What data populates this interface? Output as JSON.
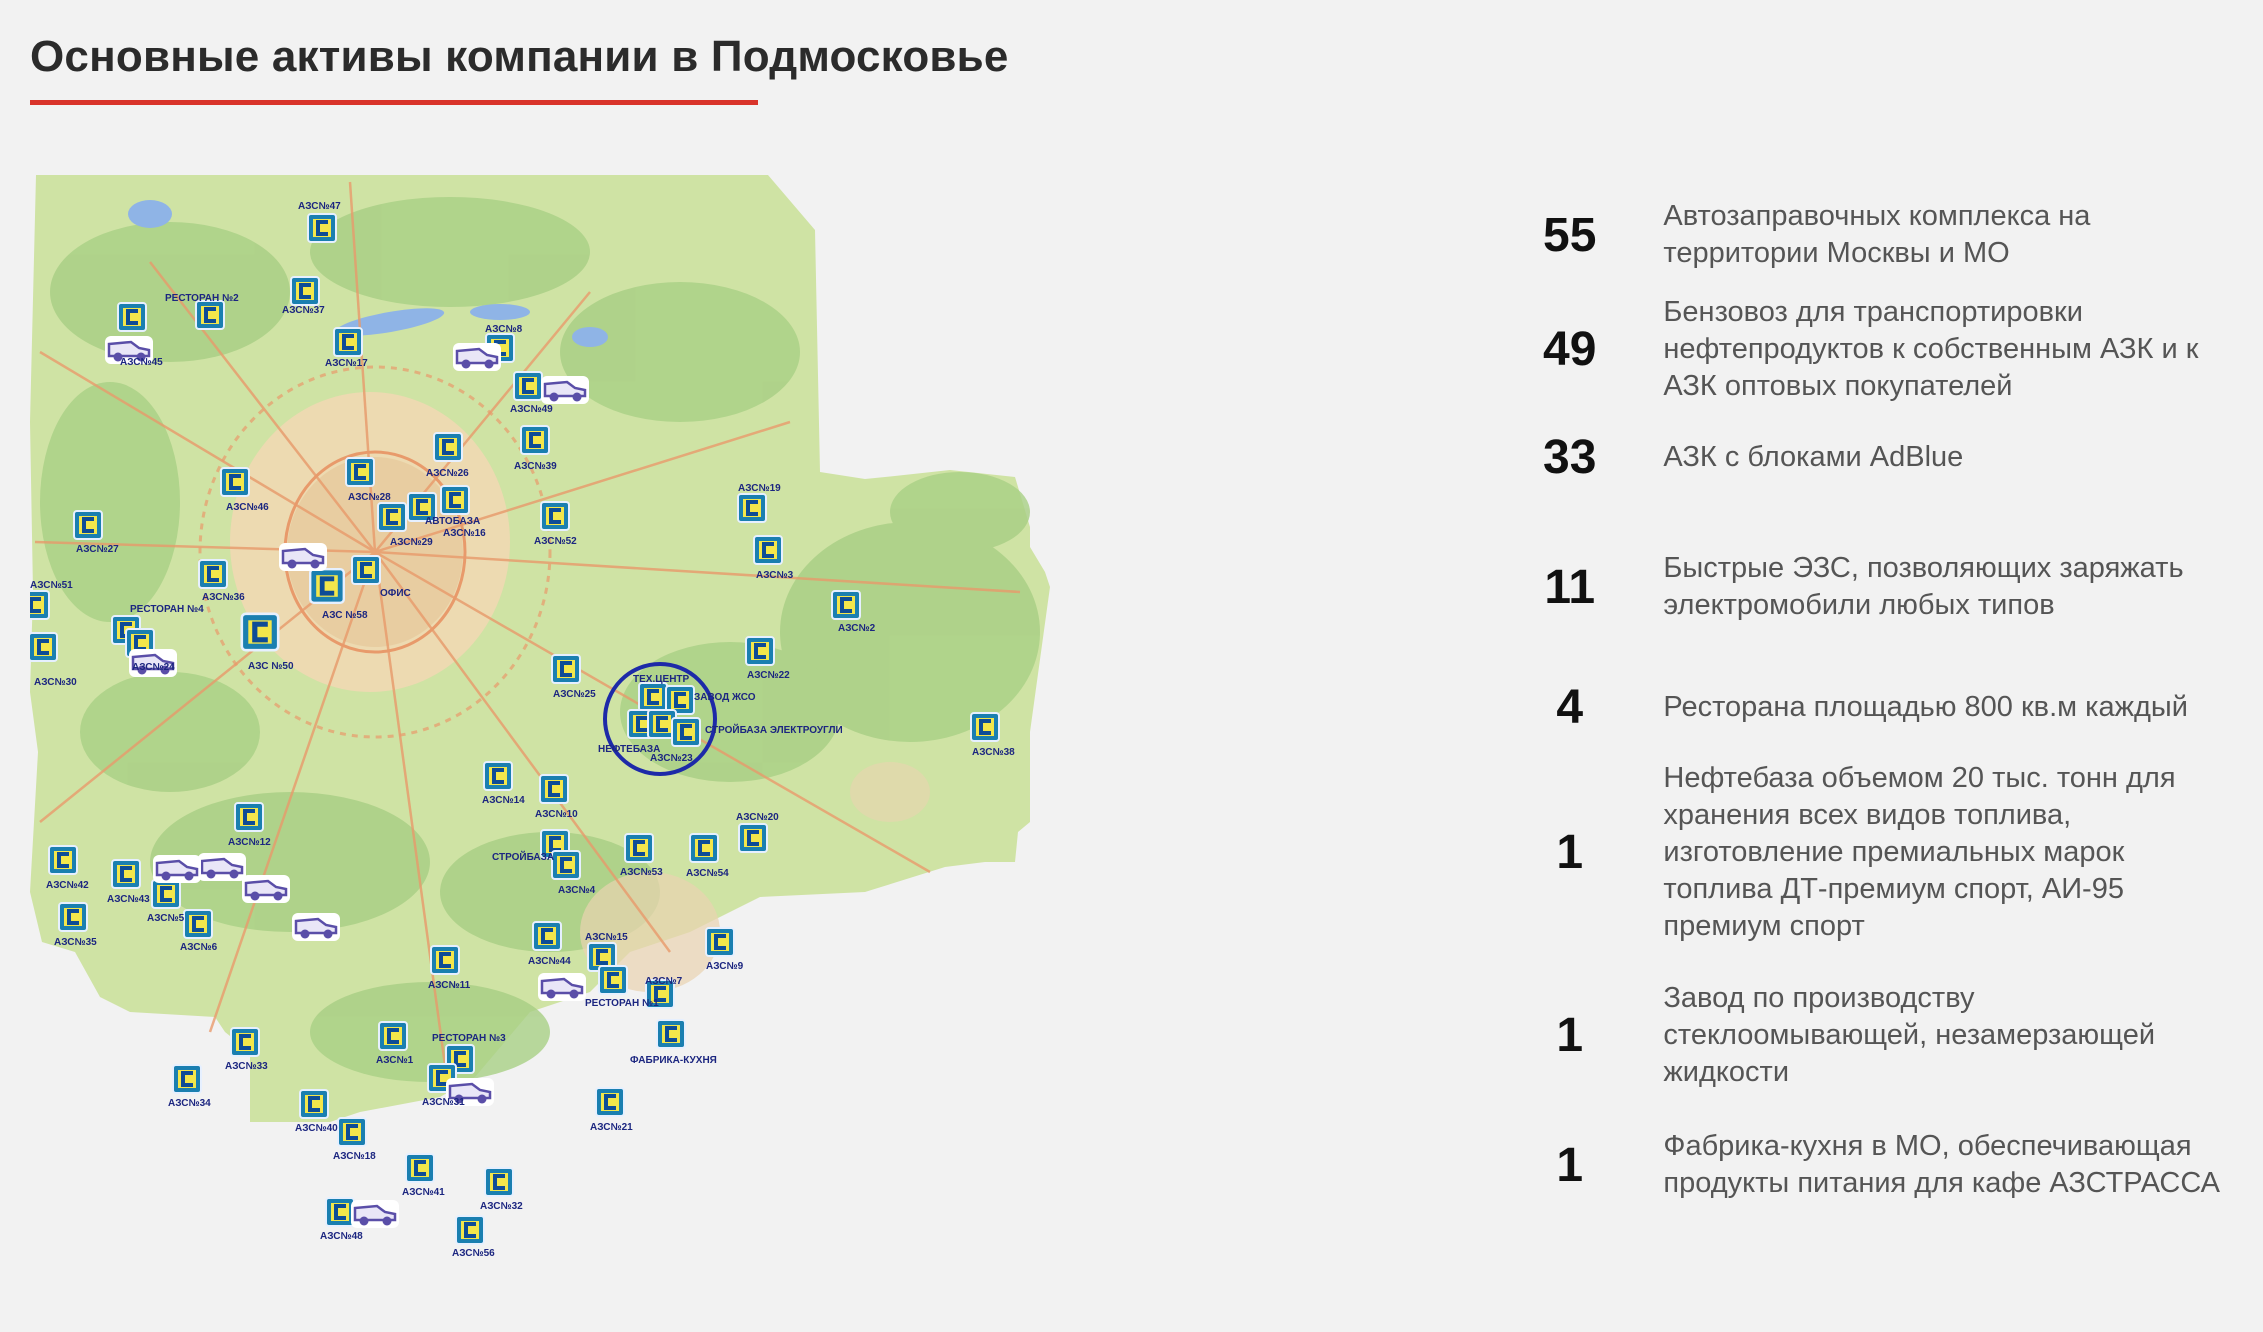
{
  "page": {
    "title": "Основные активы компании в Подмосковье",
    "accent_color": "#d9342b"
  },
  "map": {
    "marker_icon": "gas-station-icon",
    "vehicle_icon": "tanker-truck-icon",
    "labels": {
      "azs47": "АЗС№47",
      "azs37": "АЗС№37",
      "rest2": "РЕСТОРАН №2",
      "azs45": "АЗС№45",
      "azs17": "АЗС№17",
      "azs8": "АЗС№8",
      "azs49": "АЗС№49",
      "azs39": "АЗС№39",
      "azs26": "АЗС№26",
      "azs28": "АЗС№28",
      "azs46": "АЗС№46",
      "azs27": "АЗС№27",
      "azs29": "АЗС№29",
      "azs16": "АЗС№16",
      "avtobaza": "АВТОБАЗА",
      "azs52": "АЗС№52",
      "azs19": "АЗС№19",
      "azs3": "АЗС№3",
      "azs51": "АЗС№51",
      "azs36": "АЗС№36",
      "ofis": "ОФИС",
      "azs58": "АЗС №58",
      "azs2": "АЗС№2",
      "rest4": "РЕСТОРАН №4",
      "azs50": "АЗС №50",
      "azs24": "АЗС№24",
      "azs30": "АЗС№30",
      "azs22": "АЗС№22",
      "tehcentr": "ТЕХ.ЦЕНТР",
      "zavod": "ЗАВОД ЖСО",
      "azs25": "АЗС№25",
      "stroybaza_el": "СТРОЙБАЗА ЭЛЕКТРОУГЛИ",
      "neftebaza": "НЕФТЕБАЗА",
      "azs23": "АЗС№23",
      "azs38": "АЗС№38",
      "azs14": "АЗС№14",
      "azs10": "АЗС№10",
      "azs12": "АЗС№12",
      "azs20": "АЗС№20",
      "stroybaza": "СТРОЙБАЗА",
      "azs53": "АЗС№53",
      "azs54": "АЗС№54",
      "azs42": "АЗС№42",
      "azs43": "АЗС№43",
      "azs5": "АЗС№5",
      "azs4": "АЗС№4",
      "azs6": "АЗС№6",
      "azs35": "АЗС№35",
      "azs44": "АЗС№44",
      "azs15": "АЗС№15",
      "azs9": "АЗС№9",
      "azs11": "АЗС№11",
      "azs7": "АЗС№7",
      "rest1": "РЕСТОРАН №1",
      "azs33": "АЗС№33",
      "azs1": "АЗС№1",
      "rest3": "РЕСТОРАН №3",
      "fabrika": "ФАБРИКА-КУХНЯ",
      "azs34": "АЗС№34",
      "azs31": "АЗС№31",
      "azs40": "АЗС№40",
      "azs21": "АЗС№21",
      "azs18": "АЗС№18",
      "azs41": "АЗС№41",
      "azs32": "АЗС№32",
      "azs48": "АЗС№48",
      "azs56": "АЗС№56"
    }
  },
  "stats": [
    {
      "number": "55",
      "text": "Автозаправочных комплекса на территории Москвы и МО"
    },
    {
      "number": "49",
      "text": "Бензовоз для транспортировки нефтепродуктов к собственным АЗК и к АЗК оптовых покупателей"
    },
    {
      "number": "33",
      "text": "АЗК с блоками AdBlue"
    },
    {
      "number": "11",
      "text": "Быстрые ЭЗС, позволяющих заряжать электромобили любых типов"
    },
    {
      "number": "4",
      "text": "Ресторана площадью 800 кв.м каждый"
    },
    {
      "number": "1",
      "text": "Нефтебаза объемом 20 тыс. тонн для хранения всех видов топлива, изготовление премиальных марок топлива ДТ-премиум спорт, АИ-95 премиум спорт"
    },
    {
      "number": "1",
      "text": "Завод по производству стеклоомывающей, незамерзающей жидкости"
    },
    {
      "number": "1",
      "text": "Фабрика-кухня в МО, обеспечивающая продукты питания для кафе АЗСТРАССА"
    }
  ]
}
